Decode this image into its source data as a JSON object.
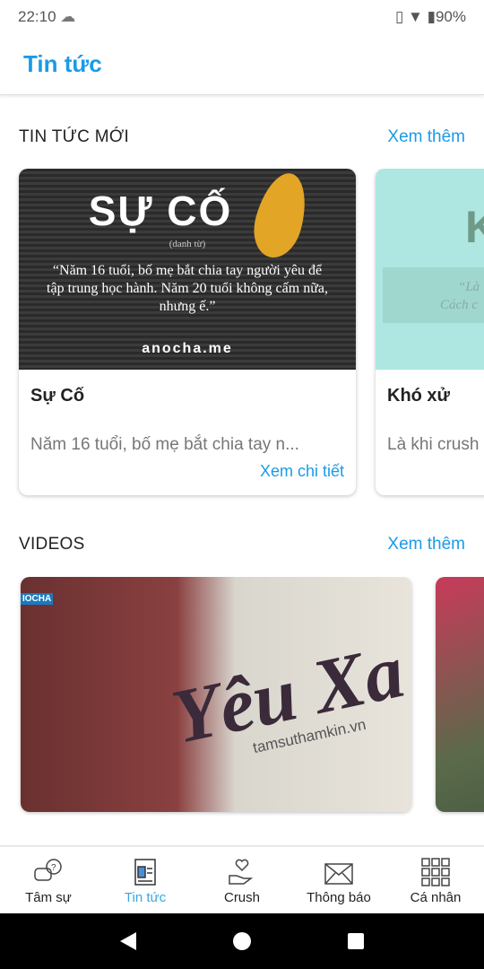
{
  "status": {
    "time": "22:10",
    "battery": "90%"
  },
  "header": {
    "title": "Tin tức"
  },
  "news": {
    "title": "TIN TỨC MỚI",
    "more": "Xem thêm",
    "items": [
      {
        "title": "Sự Cố",
        "desc": "Năm 16 tuổi, bố mẹ bắt chia tay n...",
        "detail": "Xem chi tiết",
        "image_text": {
          "heading": "SỰ CỐ",
          "sub": "(danh từ)",
          "quote": "“Năm 16 tuổi, bố mẹ bắt chia tay người yêu để tập trung học hành. Năm 20 tuổi không cấm nữa, nhưng ế.”",
          "brand": "anocha.me"
        }
      },
      {
        "title": "Khó xử",
        "desc": "Là khi crush",
        "image_text": {
          "heading": "K",
          "quote": "“Là",
          "quote2": "Cách c"
        }
      }
    ]
  },
  "videos": {
    "title": "VIDEOS",
    "more": "Xem thêm",
    "items": [
      {
        "overlay": "Yêu Xa",
        "watermark": "tamsuthamkin.vn",
        "logo": "IOCHA"
      }
    ]
  },
  "nav": {
    "items": [
      {
        "label": "Tâm sự",
        "icon": "chat-question-icon"
      },
      {
        "label": "Tin tức",
        "icon": "newspaper-icon",
        "active": true
      },
      {
        "label": "Crush",
        "icon": "heart-hand-icon"
      },
      {
        "label": "Thông báo",
        "icon": "envelope-icon"
      },
      {
        "label": "Cá nhân",
        "icon": "grid-icon"
      }
    ]
  },
  "colors": {
    "accent": "#1a9be8"
  }
}
